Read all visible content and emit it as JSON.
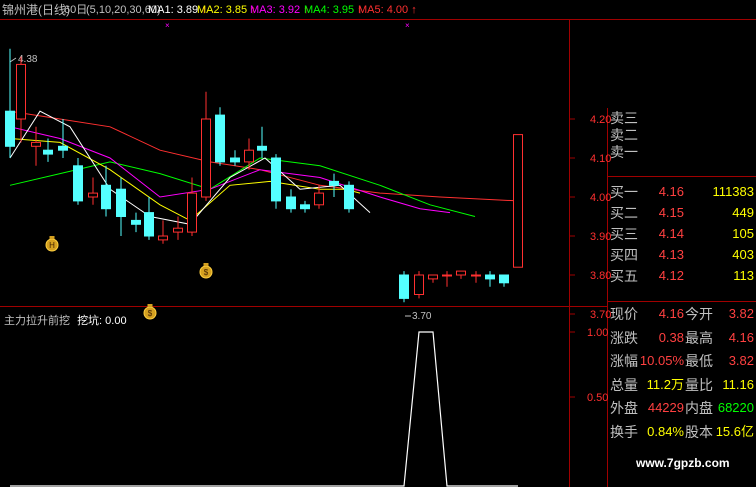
{
  "header": {
    "title": "锦州港(日线)",
    "period": "60日",
    "params": "(5,10,20,30,60)",
    "ma": [
      {
        "label": "MA1:",
        "value": "3.89",
        "color": "#ffffff"
      },
      {
        "label": "MA2:",
        "value": "3.85",
        "color": "#ffff00"
      },
      {
        "label": "MA3:",
        "value": "3.92",
        "color": "#ff00ff"
      },
      {
        "label": "MA4:",
        "value": "3.95",
        "color": "#00ff00"
      },
      {
        "label": "MA5:",
        "value": "4.00",
        "color": "#ff3030"
      }
    ],
    "arrow": "↑"
  },
  "price_axis": {
    "labels": [
      "4.20",
      "4.10",
      "4.00",
      "3.90",
      "3.80",
      "3.70"
    ],
    "max_label": "4.38",
    "min_label": "3.70"
  },
  "indicator": {
    "title": "主力拉升前挖",
    "value_label": "挖坑: 0.00",
    "axis": [
      "1.00",
      "0.50"
    ]
  },
  "quote": {
    "sell": [
      {
        "label": "卖三",
        "price": "",
        "vol": ""
      },
      {
        "label": "卖二",
        "price": "",
        "vol": ""
      },
      {
        "label": "卖一",
        "price": "",
        "vol": ""
      }
    ],
    "buy": [
      {
        "label": "买一",
        "price": "4.16",
        "vol": "111383"
      },
      {
        "label": "买二",
        "price": "4.15",
        "vol": "449"
      },
      {
        "label": "买三",
        "price": "4.14",
        "vol": "105"
      },
      {
        "label": "买四",
        "price": "4.13",
        "vol": "403"
      },
      {
        "label": "买五",
        "price": "4.12",
        "vol": "113"
      }
    ],
    "stats": [
      {
        "l1": "现价",
        "v1": "4.16",
        "c1": "#ff4040",
        "l2": "今开",
        "v2": "3.82",
        "c2": "#ff4040"
      },
      {
        "l1": "涨跌",
        "v1": "0.38",
        "c1": "#ff4040",
        "l2": "最高",
        "v2": "4.16",
        "c2": "#ff4040"
      },
      {
        "l1": "涨幅",
        "v1": "10.05%",
        "c1": "#ff4040",
        "l2": "最低",
        "v2": "3.82",
        "c2": "#ff4040"
      },
      {
        "l1": "总量",
        "v1": "11.2万",
        "c1": "#ffff00",
        "l2": "量比",
        "v2": "11.16",
        "c2": "#ffff00"
      },
      {
        "l1": "外盘",
        "v1": "44229",
        "c1": "#ff4040",
        "l2": "内盘",
        "v2": "68220",
        "c2": "#00ff00"
      },
      {
        "l1": "换手",
        "v1": "0.84%",
        "c1": "#ffff00",
        "l2": "股本",
        "v2": "15.6亿",
        "c2": "#ffff00"
      }
    ]
  },
  "watermark": "www.7gpzb.com",
  "colors": {
    "up": "#ff3030",
    "down": "#54ffff",
    "grid": "#a00000",
    "frame": "#a00000"
  }
}
